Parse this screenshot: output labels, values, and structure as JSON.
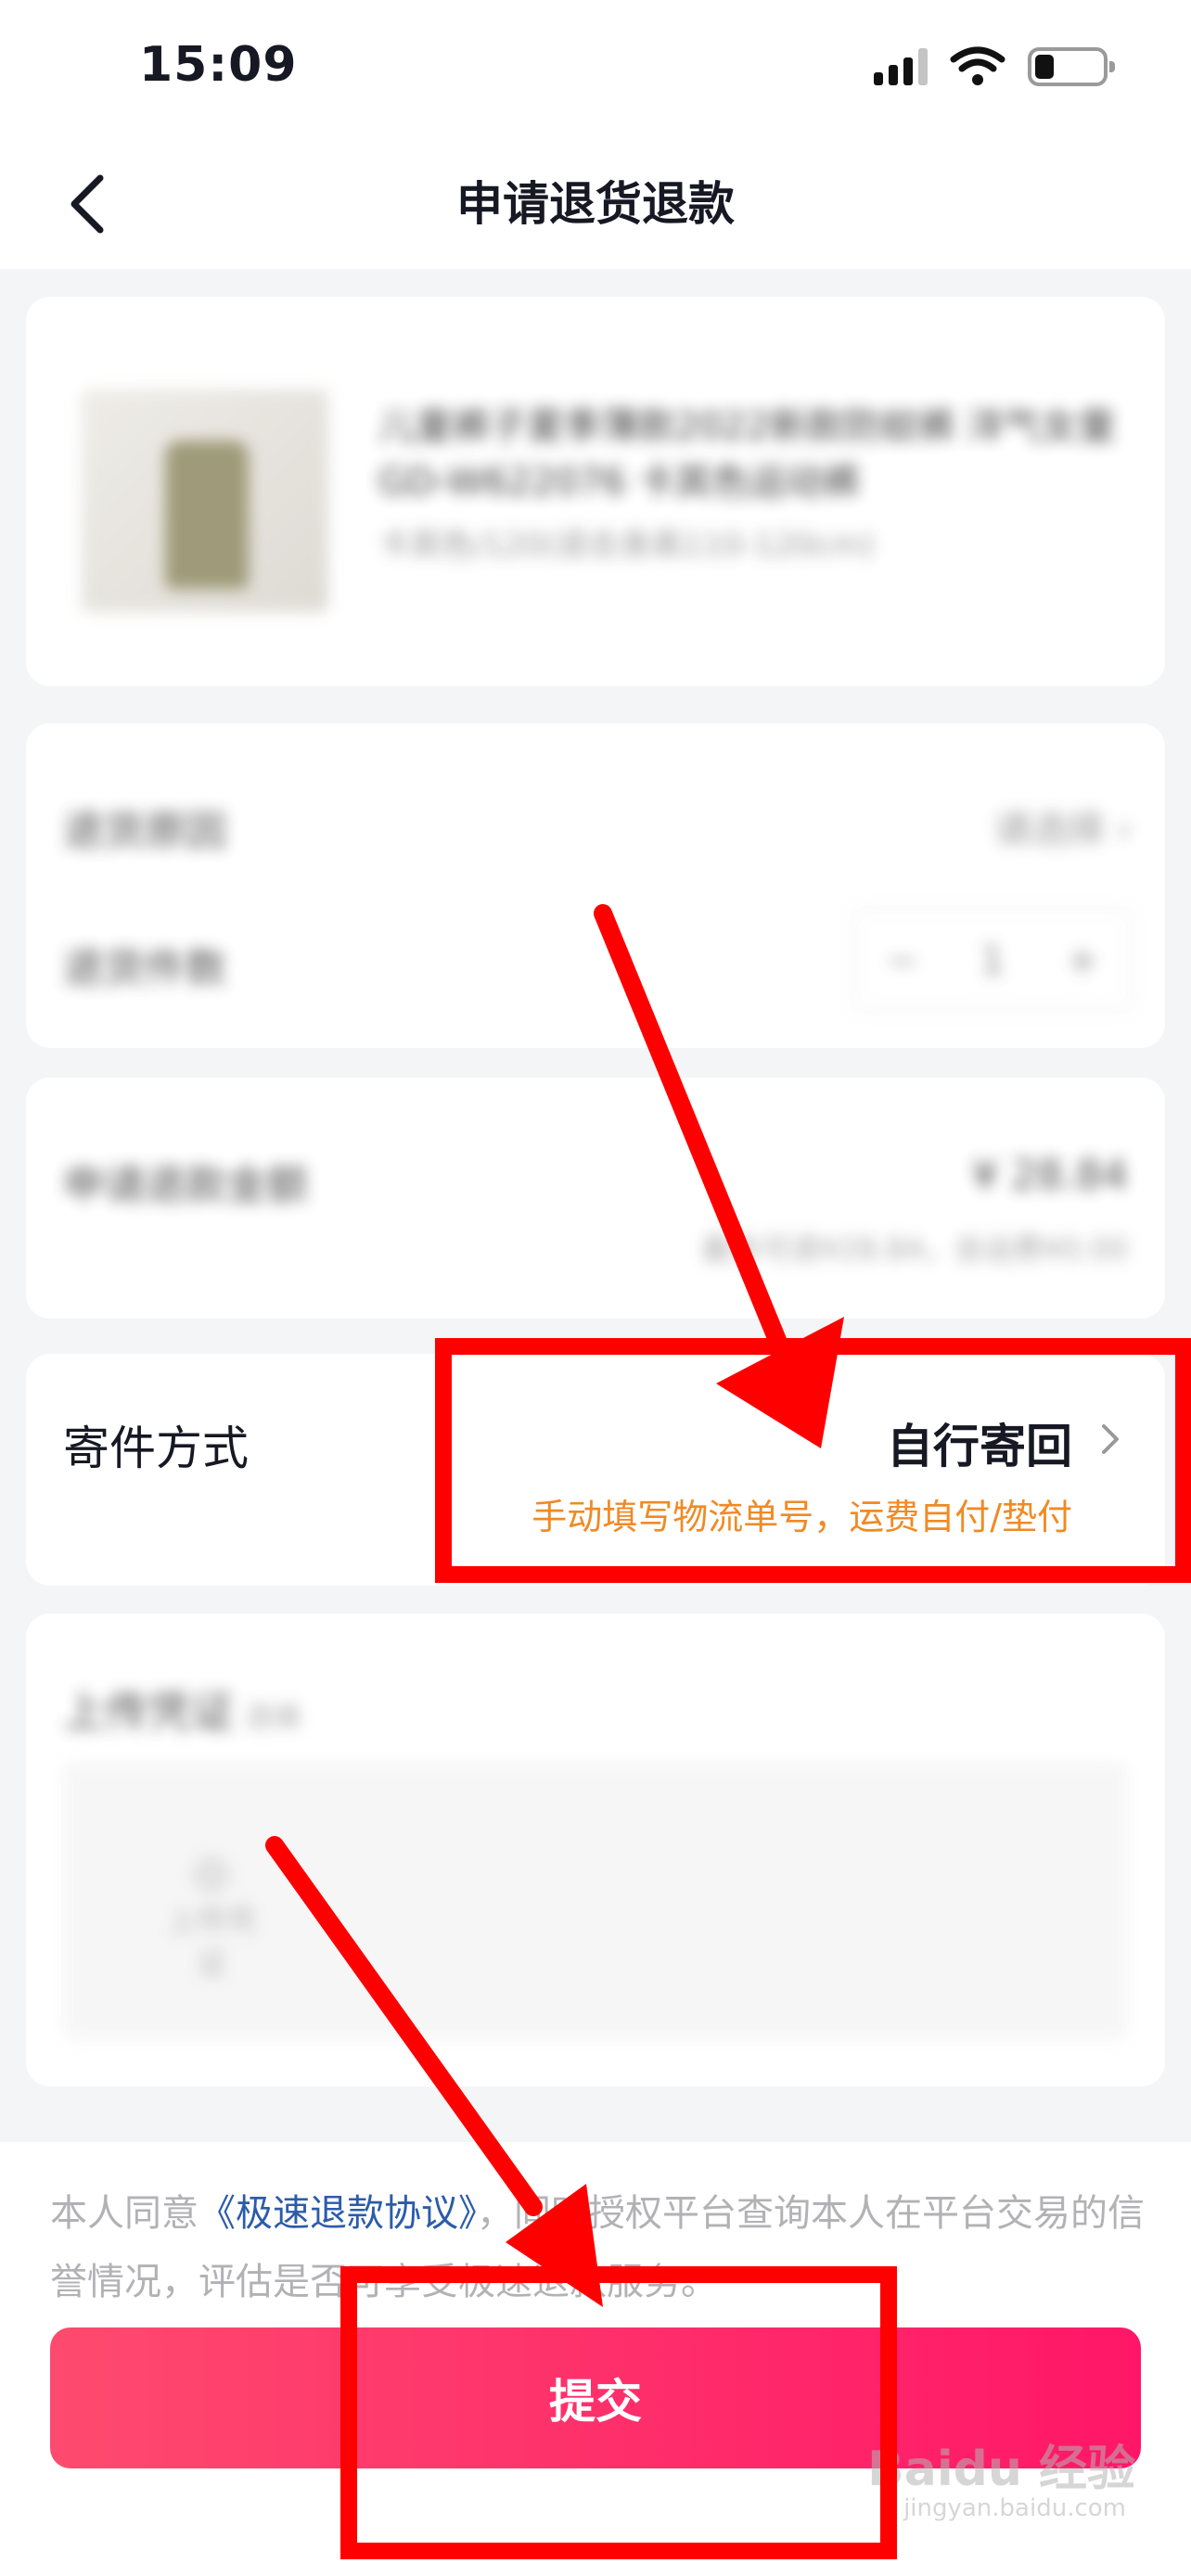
{
  "status_bar": {
    "time": "15:09",
    "battery_level": 0.2
  },
  "nav": {
    "title": "申请退货退款"
  },
  "product": {
    "name": "儿童裤子夏季薄款2022新款防蚊裤 洋气女童 GD-W622076 卡其色运动裤",
    "spec": "卡其色/120(适合身高110-120cm)"
  },
  "reason": {
    "reason_label": "退货原因",
    "reason_value": "请选择 ›",
    "quantity_label": "退货件数",
    "quantity": "1",
    "minus": "−",
    "plus": "+"
  },
  "amount": {
    "label": "申请退款金额",
    "value": "¥ 28.84",
    "note": "最多可退¥28.84，含运费¥0.00"
  },
  "shipping": {
    "label": "寄件方式",
    "value": "自行寄回",
    "hint": "手动填写物流单号，运费自付/垫付"
  },
  "upload": {
    "title": "上传凭证",
    "optional": "选填",
    "add_label": "上传凭证"
  },
  "bottom": {
    "agreement_prefix": "本人同意",
    "agreement_link": "《极速退款协议》",
    "agreement_suffix": "，同时授权平台查询本人在平台交易的信誉情况，评估是否可享受极速退款服务。",
    "submit_label": "提交"
  },
  "watermark": {
    "brand": "Baidu 经验",
    "site": "jingyan.baidu.com"
  },
  "colors": {
    "accent": "#fe2c55",
    "hint_orange": "#f08a24",
    "link_blue": "#2c5ca9",
    "annotation_red": "#ff0000"
  }
}
